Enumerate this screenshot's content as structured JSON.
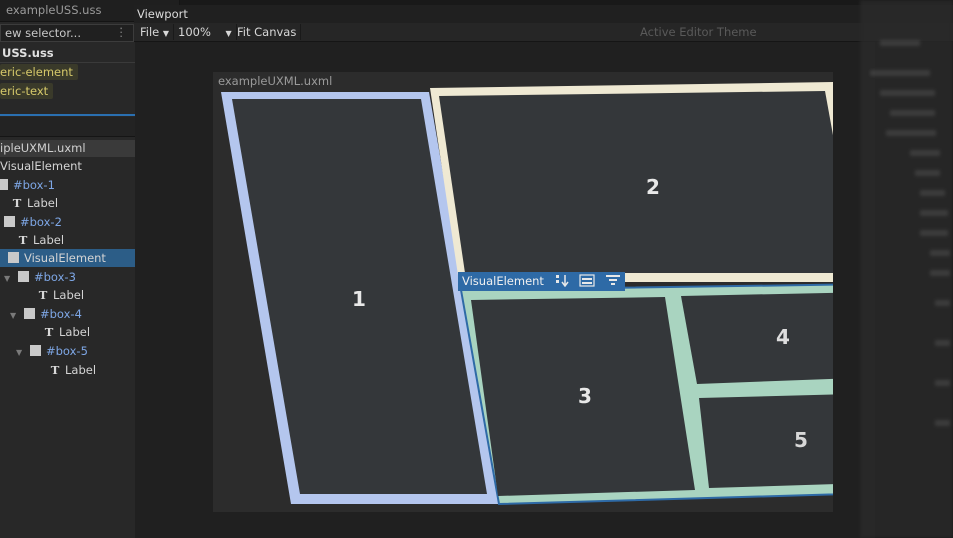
{
  "left_panel": {
    "stylesheet_tab": "exampleUSS.uss",
    "selector_placeholder": "ew selector...",
    "stylesheet_title": "USS.uss",
    "selectors": [
      "eric-element",
      "eric-text"
    ]
  },
  "hierarchy": {
    "document": "ipleUXML.uxml",
    "items": [
      {
        "label": "VisualElement",
        "kind": "plain"
      },
      {
        "label": "#box-1",
        "kind": "box"
      },
      {
        "label": "Label",
        "kind": "text"
      },
      {
        "label": "#box-2",
        "kind": "box"
      },
      {
        "label": "Label",
        "kind": "text"
      },
      {
        "label": "VisualElement",
        "kind": "box-selected"
      },
      {
        "label": "#box-3",
        "kind": "box"
      },
      {
        "label": "Label",
        "kind": "text"
      },
      {
        "label": "#box-4",
        "kind": "box"
      },
      {
        "label": "Label",
        "kind": "text"
      },
      {
        "label": "#box-5",
        "kind": "box"
      },
      {
        "label": "Label",
        "kind": "text"
      }
    ]
  },
  "viewport": {
    "title": "Viewport",
    "file_menu": "File",
    "zoom": "100%",
    "fit_canvas": "Fit Canvas",
    "theme_label": "Active Editor Theme"
  },
  "document": {
    "name": "exampleUXML.uxml",
    "box_labels": [
      "1",
      "2",
      "3",
      "4",
      "5"
    ],
    "selected_element": "VisualElement"
  },
  "colors": {
    "box1_border": "#b4c6ee",
    "box2_border": "#efe9d3",
    "box3_border": "#a9d4c0",
    "selection": "#2e6aa6",
    "box_fill": "#34373a"
  }
}
